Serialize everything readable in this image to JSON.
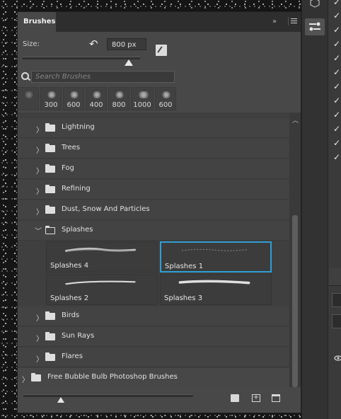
{
  "panel": {
    "tab_label": "Brushes",
    "collapse_glyph": "»",
    "menu_icon": "hamburger-icon"
  },
  "size": {
    "label": "Size:",
    "value": "800 px",
    "slider_fraction": 0.9
  },
  "search": {
    "placeholder": "Search Brushes"
  },
  "recent_brushes": [
    {
      "label": ""
    },
    {
      "label": "300"
    },
    {
      "label": "600"
    },
    {
      "label": "400"
    },
    {
      "label": "800"
    },
    {
      "label": "1000"
    },
    {
      "label": "600"
    }
  ],
  "folders_top": [
    {
      "name": "Lightning",
      "expanded": false
    },
    {
      "name": "Trees",
      "expanded": false
    },
    {
      "name": "Fog",
      "expanded": false
    },
    {
      "name": "Refining",
      "expanded": false
    },
    {
      "name": "Dust, Snow And Particles",
      "expanded": false
    },
    {
      "name": "Splashes",
      "expanded": true
    }
  ],
  "splash_brushes": [
    {
      "label": "Splashes 4",
      "selected": false
    },
    {
      "label": "Splashes 1",
      "selected": true
    },
    {
      "label": "Splashes 2",
      "selected": false
    },
    {
      "label": "Splashes 3",
      "selected": false
    }
  ],
  "folders_bottom": [
    {
      "name": "Birds",
      "expanded": false
    },
    {
      "name": "Sun Rays",
      "expanded": false
    },
    {
      "name": "Flares",
      "expanded": false
    },
    {
      "name": "Free Bubble Bulb Photoshop Brushes",
      "expanded": false
    }
  ],
  "footer": {
    "preview_slider_fraction": 0.22,
    "icons": [
      "new-group-icon",
      "new-brush-icon",
      "delete-icon"
    ]
  },
  "colors": {
    "selection": "#2e9fd6",
    "panel_bg": "#484848"
  }
}
